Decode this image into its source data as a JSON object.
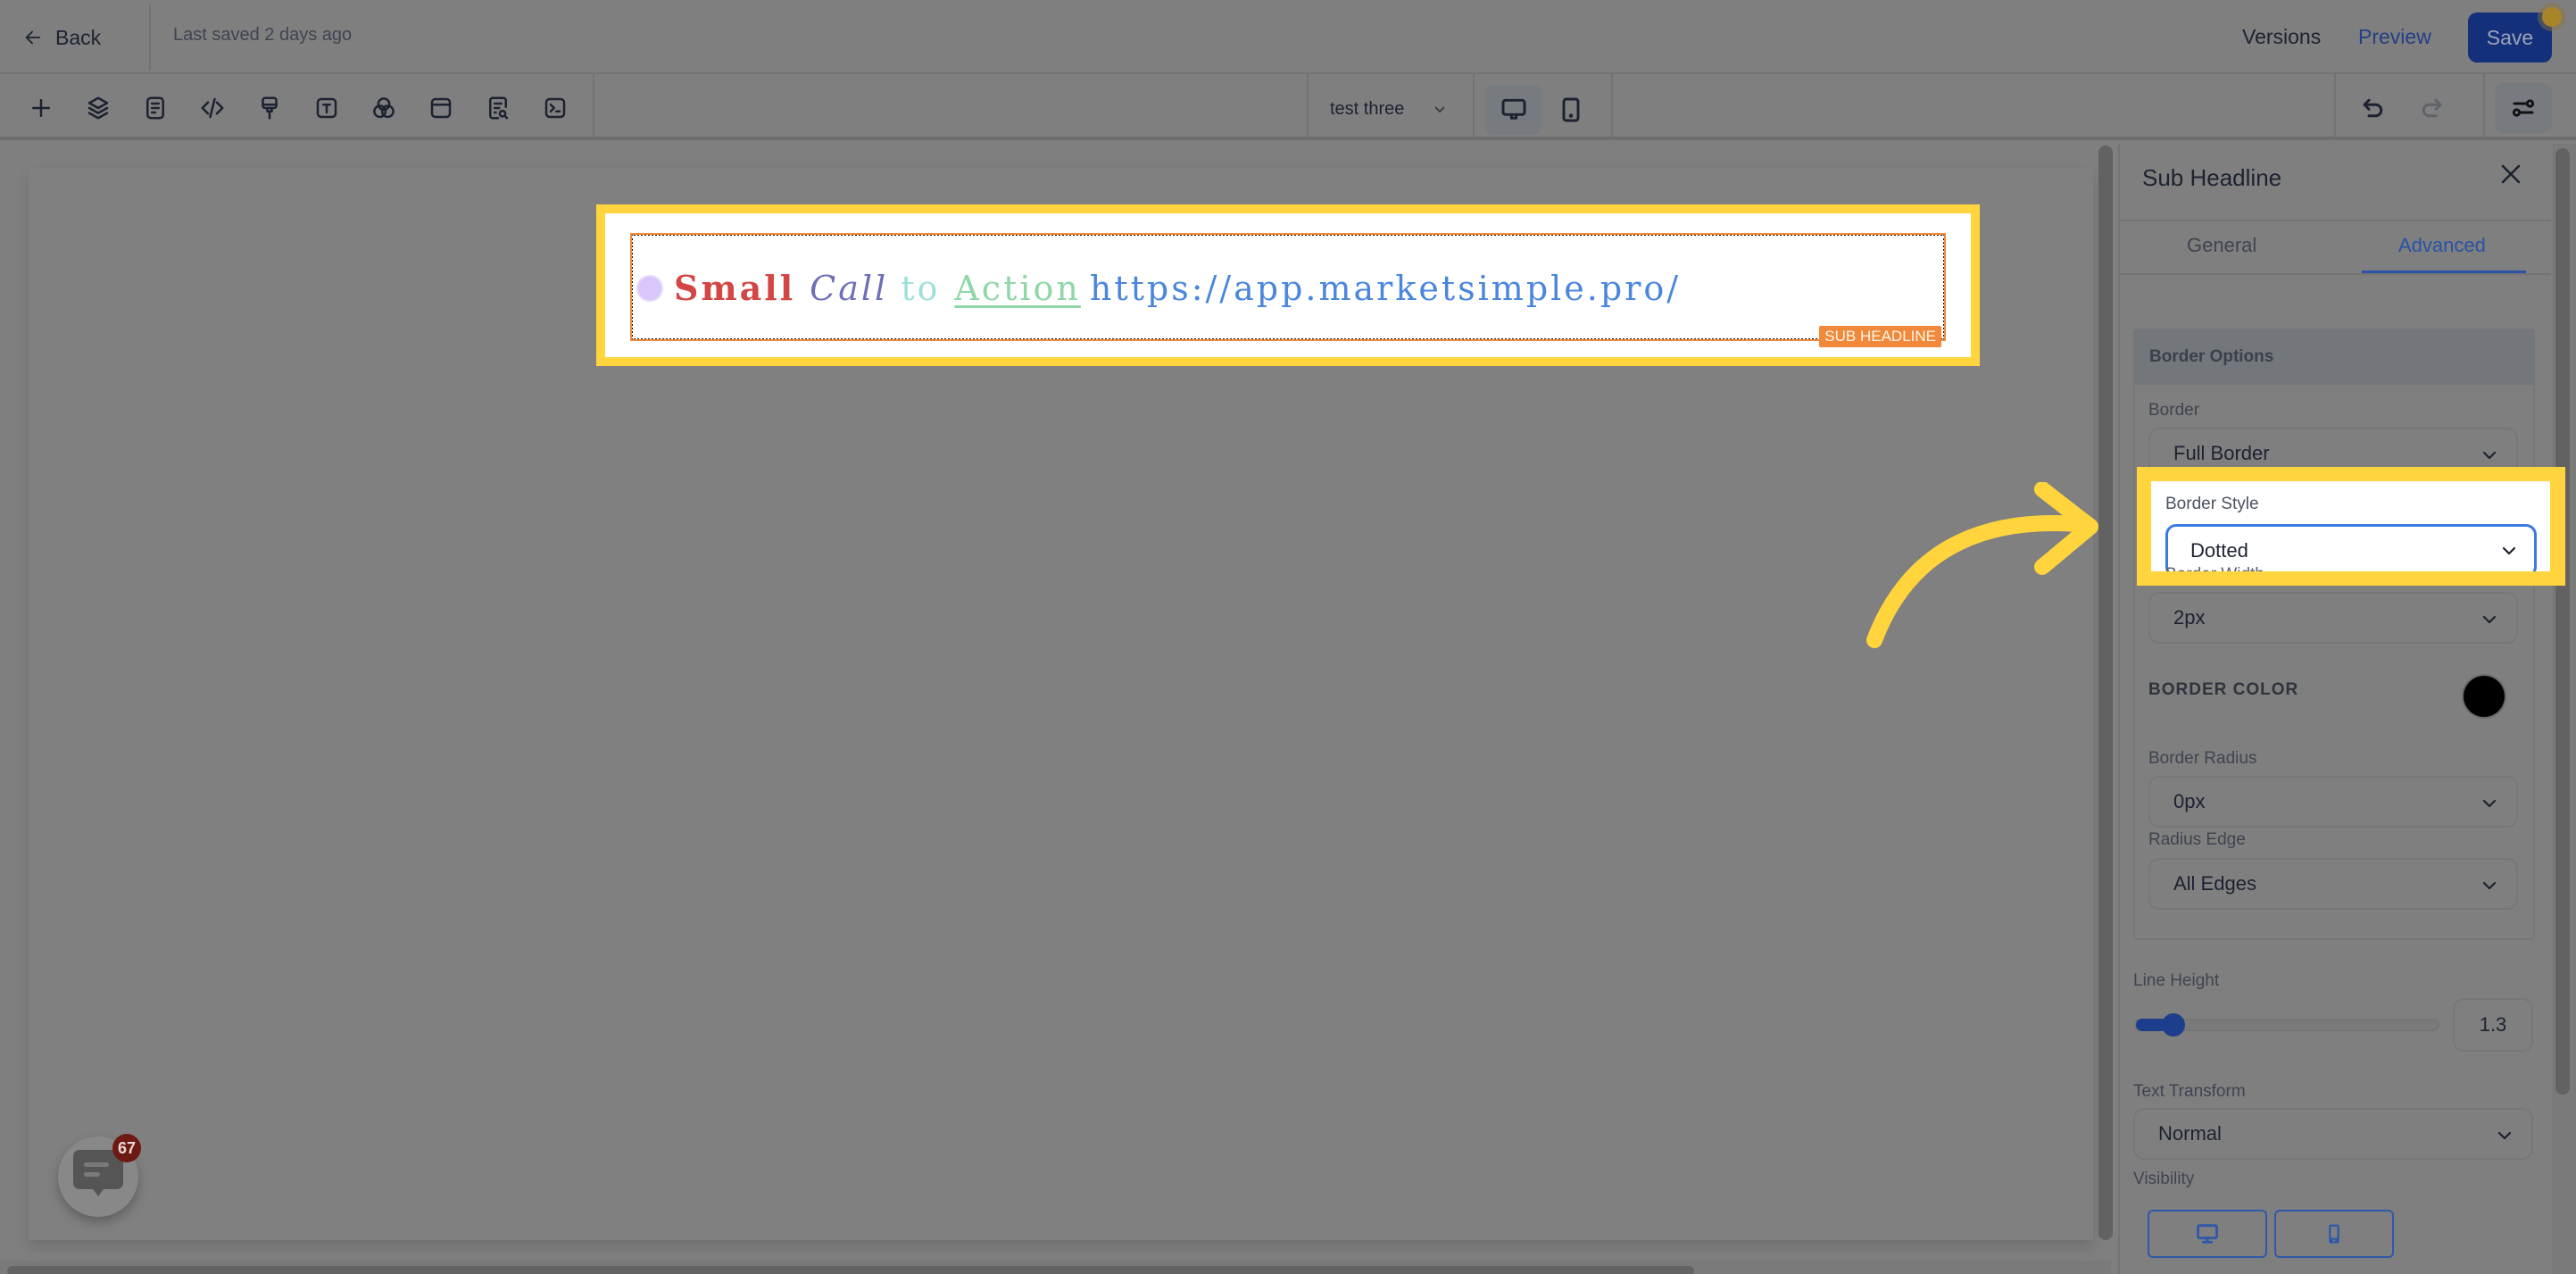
{
  "header": {
    "back_label": "Back",
    "last_saved": "Last saved 2 days ago",
    "versions_label": "Versions",
    "preview_label": "Preview",
    "save_label": "Save"
  },
  "toolbar": {
    "tools": [
      {
        "icon": "plus-icon",
        "label": "Add element"
      },
      {
        "icon": "layers-icon",
        "label": "Layers"
      },
      {
        "icon": "page-icon",
        "label": "Pages"
      },
      {
        "icon": "code-icon",
        "label": "Custom code"
      },
      {
        "icon": "paint-brush-icon",
        "label": "Styles"
      },
      {
        "icon": "text-icon",
        "label": "Typography"
      },
      {
        "icon": "color-circles-icon",
        "label": "Colors"
      },
      {
        "icon": "layout-icon",
        "label": "Layout"
      },
      {
        "icon": "seo-search-icon",
        "label": "SEO"
      },
      {
        "icon": "terminal-icon",
        "label": "Tracking code"
      }
    ],
    "page_selector": "test three",
    "device_modes": [
      {
        "icon": "desktop-icon",
        "active": true
      },
      {
        "icon": "mobile-icon",
        "active": false
      }
    ]
  },
  "canvas": {
    "headline": {
      "words": [
        {
          "text": "Small",
          "color": "#d24745",
          "style": "bold"
        },
        {
          "text": "Call",
          "color": "#6e6fb8",
          "style": "italic"
        },
        {
          "text": "to",
          "color": "#9ee0da",
          "style": "normal"
        },
        {
          "text": "Action ",
          "color": "#8fd7a6",
          "style": "underline"
        },
        {
          "text": "https://app.marketsimple.pro/",
          "color": "#4a86de",
          "style": "link"
        }
      ],
      "element_tag": "SUB HEADLINE"
    },
    "chat_badge_count": "67"
  },
  "panel": {
    "title": "Sub Headline",
    "tabs": [
      {
        "label": "General",
        "active": false
      },
      {
        "label": "Advanced",
        "active": true
      }
    ],
    "section_title": "Border Options",
    "fields": {
      "border": {
        "label": "Border",
        "value": "Full Border"
      },
      "border_style": {
        "label": "Border Style",
        "value": "Dotted"
      },
      "border_width": {
        "label": "Border Width",
        "value": "2px"
      },
      "border_color": {
        "label": "BORDER COLOR",
        "value": "#000000"
      },
      "border_radius": {
        "label": "Border Radius",
        "value": "0px"
      },
      "radius_edge": {
        "label": "Radius Edge",
        "value": "All Edges"
      },
      "line_height": {
        "label": "Line Height",
        "value": "1.3",
        "slider_fraction": 0.05
      },
      "text_transform": {
        "label": "Text Transform",
        "value": "Normal"
      },
      "visibility": {
        "label": "Visibility",
        "options": [
          "desktop",
          "mobile"
        ]
      }
    }
  },
  "colors": {
    "accent": "#2a52a7",
    "highlight": "#ffd43d",
    "element_tag": "#f08a3a",
    "save_button": "#15307a"
  }
}
